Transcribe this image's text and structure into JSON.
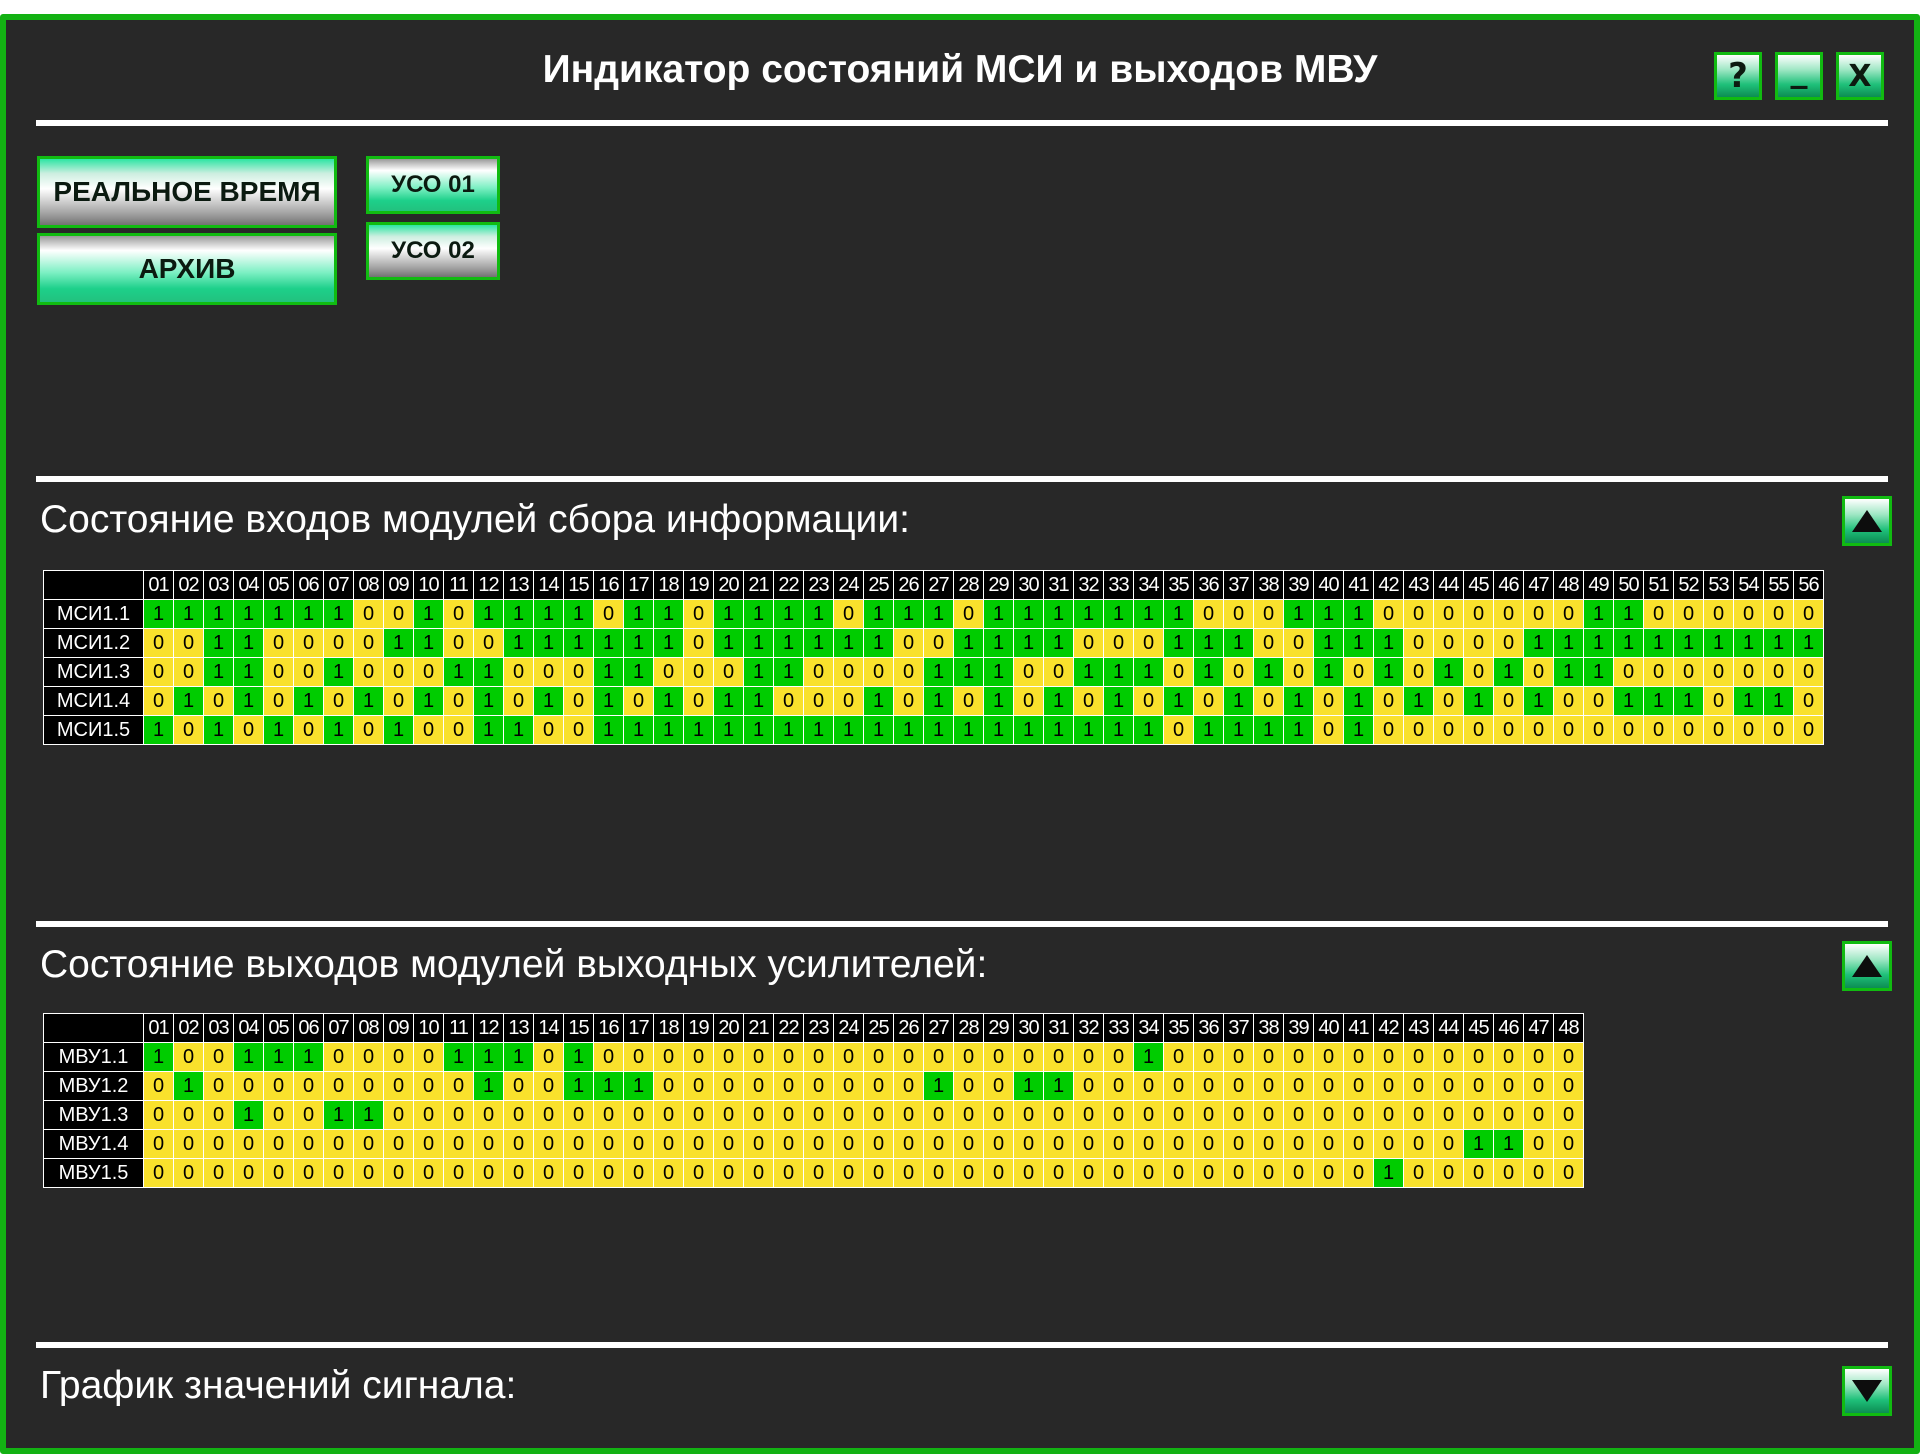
{
  "window": {
    "title": "Индикатор состояний МСИ и выходов МВУ",
    "help_label": "?",
    "minimize_label": "_",
    "close_label": "X"
  },
  "mode_buttons": {
    "realtime_label": "РЕАЛЬНОЕ ВРЕМЯ",
    "archive_label": "АРХИВ"
  },
  "uso_buttons": {
    "uso01_label": "УСО 01",
    "uso02_label": "УСО 02"
  },
  "msi_section": {
    "title": "Состояние входов модулей сбора информации:",
    "columns": [
      "01",
      "02",
      "03",
      "04",
      "05",
      "06",
      "07",
      "08",
      "09",
      "10",
      "11",
      "12",
      "13",
      "14",
      "15",
      "16",
      "17",
      "18",
      "19",
      "20",
      "21",
      "22",
      "23",
      "24",
      "25",
      "26",
      "27",
      "28",
      "29",
      "30",
      "31",
      "32",
      "33",
      "34",
      "35",
      "36",
      "37",
      "38",
      "39",
      "40",
      "41",
      "42",
      "43",
      "44",
      "45",
      "46",
      "47",
      "48",
      "49",
      "50",
      "51",
      "52",
      "53",
      "54",
      "55",
      "56"
    ],
    "rows": [
      {
        "label": "МСИ1.1",
        "values": "11111110010111101101111011101111111000111000000011000000"
      },
      {
        "label": "МСИ1.2",
        "values": "00110000110011111101111110011110001110011100001111111111"
      },
      {
        "label": "МСИ1.3",
        "values": "00110010001100011000110000111001110101010101010110000000"
      },
      {
        "label": "МСИ1.4",
        "values": "01010101010101010101100010101010101010101010101001110110"
      },
      {
        "label": "МСИ1.5",
        "values": "10101010100110011111111111111111110111101000000000000000"
      }
    ]
  },
  "mvu_section": {
    "title": "Состояние выходов модулей выходных усилителей:",
    "columns": [
      "01",
      "02",
      "03",
      "04",
      "05",
      "06",
      "07",
      "08",
      "09",
      "10",
      "11",
      "12",
      "13",
      "14",
      "15",
      "16",
      "17",
      "18",
      "19",
      "20",
      "21",
      "22",
      "23",
      "24",
      "25",
      "26",
      "27",
      "28",
      "29",
      "30",
      "31",
      "32",
      "33",
      "34",
      "35",
      "36",
      "37",
      "38",
      "39",
      "40",
      "41",
      "42",
      "43",
      "44",
      "45",
      "46",
      "47",
      "48"
    ],
    "rows": [
      {
        "label": "МВУ1.1",
        "values": "100111000011101000000000000000000100000000000000"
      },
      {
        "label": "МВУ1.2",
        "values": "010000000001001110000000001001100000000000000000"
      },
      {
        "label": "МВУ1.3",
        "values": "000100110000000000000000000000000000000000000000"
      },
      {
        "label": "МВУ1.4",
        "values": "000000000000000000000000000000000000000000001100"
      },
      {
        "label": "МВУ1.5",
        "values": "000000000000000000000000000000000000000001000000"
      }
    ]
  },
  "signal_section": {
    "title": "График значений сигнала:"
  },
  "colors": {
    "frame": "#13b113",
    "background": "#282828",
    "state_on": "#00cc00",
    "state_off": "#f9e12c"
  }
}
